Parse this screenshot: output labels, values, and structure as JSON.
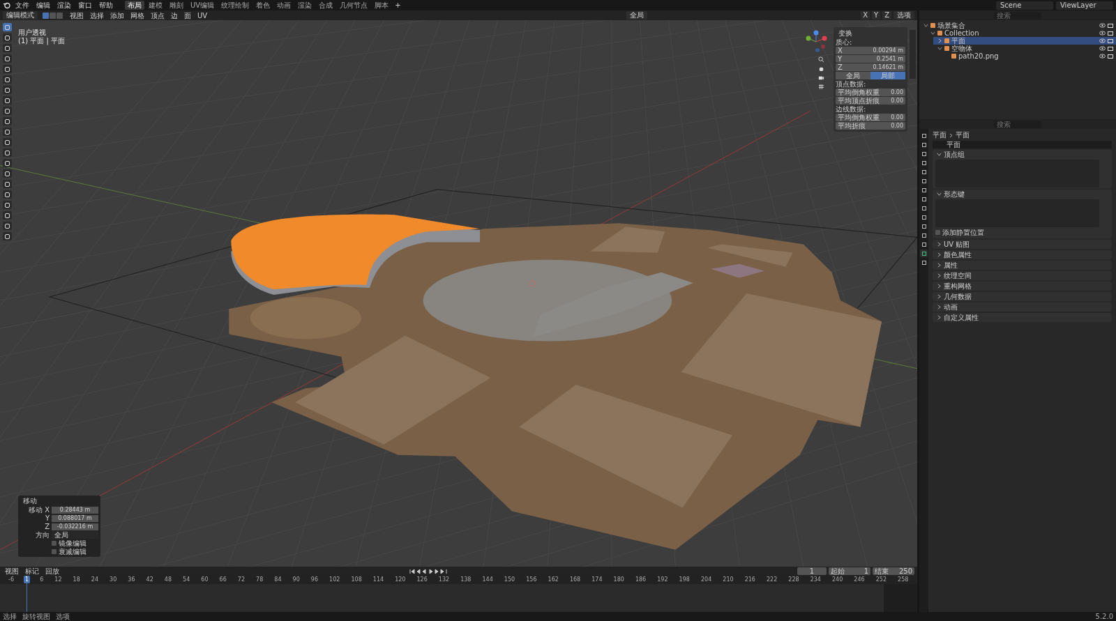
{
  "menu_bar": {
    "menus": [
      "文件",
      "编辑",
      "渲染",
      "窗口",
      "帮助"
    ],
    "workspaces": [
      {
        "label": "布局",
        "selected": true
      },
      {
        "label": "建模",
        "selected": false
      },
      {
        "label": "雕刻",
        "selected": false
      },
      {
        "label": "UV编辑",
        "selected": false
      },
      {
        "label": "纹理绘制",
        "selected": false
      },
      {
        "label": "着色",
        "selected": false
      },
      {
        "label": "动画",
        "selected": false
      },
      {
        "label": "渲染",
        "selected": false
      },
      {
        "label": "合成",
        "selected": false
      },
      {
        "label": "几何节点",
        "selected": false
      },
      {
        "label": "脚本",
        "selected": false
      }
    ],
    "add_tab": "+",
    "scene": "Scene",
    "view_layer": "ViewLayer"
  },
  "viewport_header": {
    "mode": "编辑模式",
    "select_modes": [
      {
        "selected": true
      },
      {
        "selected": false
      },
      {
        "selected": false
      }
    ],
    "menus": [
      "视图",
      "选择",
      "添加",
      "网格",
      "顶点",
      "边",
      "面",
      "UV"
    ],
    "orientation": "全局",
    "axes": [
      "X",
      "Y",
      "Z"
    ],
    "options": "选项"
  },
  "viewport": {
    "view_name": "用户透视",
    "object_info": "(1) 平面 | 平面"
  },
  "tools": [
    {
      "selected": true
    },
    {
      "selected": false
    },
    {
      "selected": false
    },
    {
      "selected": false
    },
    {
      "selected": false
    },
    {
      "selected": false
    },
    {
      "selected": false
    },
    {
      "selected": false
    },
    {
      "selected": false
    },
    {
      "selected": false
    },
    {
      "selected": false
    },
    {
      "selected": false
    },
    {
      "selected": false
    },
    {
      "selected": false
    },
    {
      "selected": false
    },
    {
      "selected": false
    },
    {
      "selected": false
    },
    {
      "selected": false
    },
    {
      "selected": false
    },
    {
      "selected": false
    },
    {
      "selected": false
    }
  ],
  "n_panel": {
    "title": "变换",
    "median_label": "质心:",
    "fields": [
      {
        "label": "X",
        "value": "0.00294 m"
      },
      {
        "label": "Y",
        "value": "0.2541 m"
      },
      {
        "label": "Z",
        "value": "0.14621 m"
      }
    ],
    "space_toggle": [
      {
        "label": "全局",
        "selected": false
      },
      {
        "label": "局部",
        "selected": true
      }
    ],
    "vertex_data_label": "顶点数据:",
    "vertex_fields": [
      {
        "label": "平均倒角权重",
        "value": "0.00"
      },
      {
        "label": "平均顶点折痕",
        "value": "0.00"
      }
    ],
    "edge_data_label": "边线数据:",
    "edge_fields": [
      {
        "label": "平均倒角权重",
        "value": "0.00"
      },
      {
        "label": "平均折痕",
        "value": "0.00"
      }
    ]
  },
  "operator_panel": {
    "title": "移动",
    "fields": [
      {
        "label": "移动 X",
        "value": "0.28443 m"
      },
      {
        "label": "Y",
        "value": "0.088017 m"
      },
      {
        "label": "Z",
        "value": "-0.032216 m"
      }
    ],
    "orientation_label": "方向",
    "orientation": "全局",
    "checkboxes": [
      {
        "label": "镜像编辑",
        "checked": false
      },
      {
        "label": "衰减编辑",
        "checked": false
      }
    ]
  },
  "outliner": {
    "search_placeholder": "搜索",
    "tree": [
      {
        "label": "场景集合",
        "expanded": true,
        "selected": false,
        "children": [
          {
            "label": "Collection",
            "expanded": true,
            "selected": false,
            "children": [
              {
                "label": "平面",
                "expanded": false,
                "selected": true
              },
              {
                "label": "空物体",
                "expanded": true,
                "selected": false,
                "children": [
                  {
                    "label": "path20.png",
                    "selected": false
                  }
                ]
              }
            ]
          }
        ]
      }
    ]
  },
  "properties": {
    "search_placeholder": "搜索",
    "tabs": [
      {
        "selected": false
      },
      {
        "selected": false
      },
      {
        "selected": false
      },
      {
        "selected": false
      },
      {
        "selected": false
      },
      {
        "selected": false
      },
      {
        "selected": false
      },
      {
        "selected": false
      },
      {
        "selected": false
      },
      {
        "selected": false
      },
      {
        "selected": false
      },
      {
        "selected": false
      },
      {
        "selected": false
      },
      {
        "selected": true
      },
      {
        "selected": false
      }
    ],
    "breadcrumb": [
      "平面",
      "平面"
    ],
    "data_name": "平面",
    "panels": [
      {
        "label": "顶点组",
        "expanded": true
      },
      {
        "label": "形态键",
        "expanded": true,
        "checkbox": {
          "label": "添加静置位置",
          "checked": false
        }
      },
      {
        "label": "UV 贴图",
        "expanded": false
      },
      {
        "label": "颜色属性",
        "expanded": false
      },
      {
        "label": "属性",
        "expanded": false
      },
      {
        "label": "纹理空间",
        "expanded": false
      },
      {
        "label": "重构网格",
        "expanded": false
      },
      {
        "label": "几何数据",
        "expanded": false
      },
      {
        "label": "动画",
        "expanded": false
      },
      {
        "label": "自定义属性",
        "expanded": false
      }
    ]
  },
  "timeline": {
    "menus": [
      "视图",
      "标记",
      "回放"
    ],
    "current_frame": "1",
    "start_label": "起始",
    "start": "1",
    "end_label": "结束",
    "end": "250",
    "ruler": [
      {
        "label": "-6",
        "selected": false
      },
      {
        "label": "1",
        "selected": true
      },
      {
        "label": "6",
        "selected": false
      },
      {
        "label": "12",
        "selected": false
      },
      {
        "label": "18",
        "selected": false
      },
      {
        "label": "24",
        "selected": false
      },
      {
        "label": "30",
        "selected": false
      },
      {
        "label": "36",
        "selected": false
      },
      {
        "label": "42",
        "selected": false
      },
      {
        "label": "48",
        "selected": false
      },
      {
        "label": "54",
        "selected": false
      },
      {
        "label": "60",
        "selected": false
      },
      {
        "label": "66",
        "selected": false
      },
      {
        "label": "72",
        "selected": false
      },
      {
        "label": "78",
        "selected": false
      },
      {
        "label": "84",
        "selected": false
      },
      {
        "label": "90",
        "selected": false
      },
      {
        "label": "96",
        "selected": false
      },
      {
        "label": "102",
        "selected": false
      },
      {
        "label": "108",
        "selected": false
      },
      {
        "label": "114",
        "selected": false
      },
      {
        "label": "120",
        "selected": false
      },
      {
        "label": "126",
        "selected": false
      },
      {
        "label": "132",
        "selected": false
      },
      {
        "label": "138",
        "selected": false
      },
      {
        "label": "144",
        "selected": false
      },
      {
        "label": "150",
        "selected": false
      },
      {
        "label": "156",
        "selected": false
      },
      {
        "label": "162",
        "selected": false
      },
      {
        "label": "168",
        "selected": false
      },
      {
        "label": "174",
        "selected": false
      },
      {
        "label": "180",
        "selected": false
      },
      {
        "label": "186",
        "selected": false
      },
      {
        "label": "192",
        "selected": false
      },
      {
        "label": "198",
        "selected": false
      },
      {
        "label": "204",
        "selected": false
      },
      {
        "label": "210",
        "selected": false
      },
      {
        "label": "216",
        "selected": false
      },
      {
        "label": "222",
        "selected": false
      },
      {
        "label": "228",
        "selected": false
      },
      {
        "label": "234",
        "selected": false
      },
      {
        "label": "240",
        "selected": false
      },
      {
        "label": "246",
        "selected": false
      },
      {
        "label": "252",
        "selected": false
      },
      {
        "label": "258",
        "selected": false
      }
    ]
  },
  "status_bar": {
    "hints": [
      "选择",
      "旋转视图",
      "选项"
    ],
    "version": "5.2.0"
  }
}
